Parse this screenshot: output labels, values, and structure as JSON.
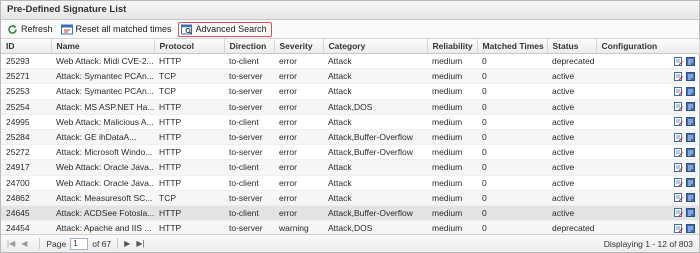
{
  "title": "Pre-Defined Signature List",
  "toolbar": {
    "refresh": "Refresh",
    "reset": "Reset all matched times",
    "advanced": "Advanced Search"
  },
  "columns": [
    "ID",
    "Name",
    "Protocol",
    "Direction",
    "Severity",
    "Category",
    "Reliability",
    "Matched Times",
    "Status",
    "Configuration"
  ],
  "rows": [
    [
      "25293",
      "Web Attack: Midi CVE-2...",
      "HTTP",
      "to-client",
      "error",
      "Attack",
      "medium",
      "0",
      "deprecated"
    ],
    [
      "25271",
      "Attack: Symantec PCAn...",
      "TCP",
      "to-server",
      "error",
      "Attack",
      "medium",
      "0",
      "active"
    ],
    [
      "25253",
      "Attack: Symantec PCAn...",
      "TCP",
      "to-server",
      "error",
      "Attack",
      "medium",
      "0",
      "active"
    ],
    [
      "25254",
      "Attack: MS ASP.NET Ha...",
      "HTTP",
      "to-server",
      "error",
      "Attack,DOS",
      "medium",
      "0",
      "active"
    ],
    [
      "24995",
      "Web Attack: Malicious A...",
      "HTTP",
      "to-client",
      "error",
      "Attack",
      "medium",
      "0",
      "active"
    ],
    [
      "25284",
      "Attack: GE ihDataA...",
      "HTTP",
      "to-server",
      "error",
      "Attack,Buffer-Overflow",
      "medium",
      "0",
      "active"
    ],
    [
      "25272",
      "Attack: Microsoft Windo...",
      "HTTP",
      "to-server",
      "error",
      "Attack,Buffer-Overflow",
      "medium",
      "0",
      "active"
    ],
    [
      "24917",
      "Web Attack: Oracle Java...",
      "HTTP",
      "to-client",
      "error",
      "Attack",
      "medium",
      "0",
      "active"
    ],
    [
      "24700",
      "Web Attack: Oracle Java...",
      "HTTP",
      "to-client",
      "error",
      "Attack",
      "medium",
      "0",
      "active"
    ],
    [
      "24862",
      "Attack: Measuresoft SC...",
      "TCP",
      "to-server",
      "error",
      "Attack",
      "medium",
      "0",
      "active"
    ],
    [
      "24645",
      "Attack: ACDSee Fotosla...",
      "HTTP",
      "to-client",
      "error",
      "Attack,Buffer-Overflow",
      "medium",
      "0",
      "active"
    ],
    [
      "24454",
      "Attack: Apache and IIS ...",
      "HTTP",
      "to-server",
      "warning",
      "Attack,DOS",
      "medium",
      "0",
      "deprecated"
    ]
  ],
  "selected_row": 10,
  "pager": {
    "page_label": "Page",
    "page_value": "1",
    "of_label": "of 67",
    "display": "Displaying 1 - 12 of 803"
  },
  "colors": {
    "accent": "#d9534f",
    "icon_blue": "#3b6fb6"
  }
}
